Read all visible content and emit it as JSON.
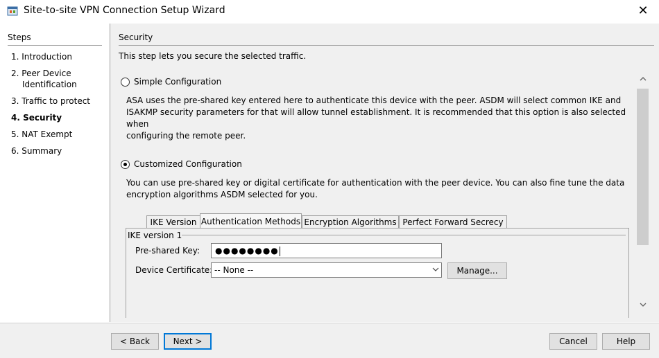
{
  "window": {
    "title": "Site-to-site VPN Connection Setup Wizard"
  },
  "steps": {
    "title": "Steps",
    "items": [
      {
        "label": "1. Introduction"
      },
      {
        "label": "2. Peer Device"
      },
      {
        "label": "Identification"
      },
      {
        "label": "3. Traffic to protect"
      },
      {
        "label": "4. Security"
      },
      {
        "label": "5. NAT Exempt"
      },
      {
        "label": "6. Summary"
      }
    ]
  },
  "section": {
    "title": "Security",
    "description": "This step lets you secure the selected traffic."
  },
  "simple": {
    "label": "Simple Configuration",
    "selected": false,
    "desc_lines": [
      "ASA uses the pre-shared key entered here to authenticate this device with the peer. ASDM will select common IKE and",
      "ISAKMP security parameters for that will allow tunnel establishment. It is recommended that this option is also selected when",
      "configuring the remote peer."
    ]
  },
  "custom": {
    "label": "Customized Configuration",
    "selected": true,
    "desc_lines": [
      "You can use pre-shared key or digital certificate for authentication with the peer device. You can also fine tune the data",
      "encryption algorithms ASDM selected for you."
    ]
  },
  "tabs": [
    {
      "label": "IKE Version"
    },
    {
      "label": "Authentication Methods",
      "selected": true
    },
    {
      "label": "Encryption Algorithms"
    },
    {
      "label": "Perfect Forward Secrecy"
    }
  ],
  "auth": {
    "group_label": "IKE version 1",
    "psk_label": "Pre-shared Key:",
    "psk_value": "●●●●●●●●",
    "cert_label": "Device Certificate:",
    "cert_value": "-- None --",
    "manage_label": "Manage..."
  },
  "footer": {
    "back_label": "< Back",
    "next_label": "Next >",
    "cancel_label": "Cancel",
    "help_label": "Help"
  },
  "icons": {
    "app": "asdm-wizard-icon",
    "close": "close-icon",
    "scroll_up": "chevron-up-icon",
    "scroll_down": "chevron-down-icon",
    "dropdown": "chevron-down-icon"
  },
  "colors": {
    "default_button_border": "#0078d7",
    "panel_bg": "#f0f0f0"
  }
}
